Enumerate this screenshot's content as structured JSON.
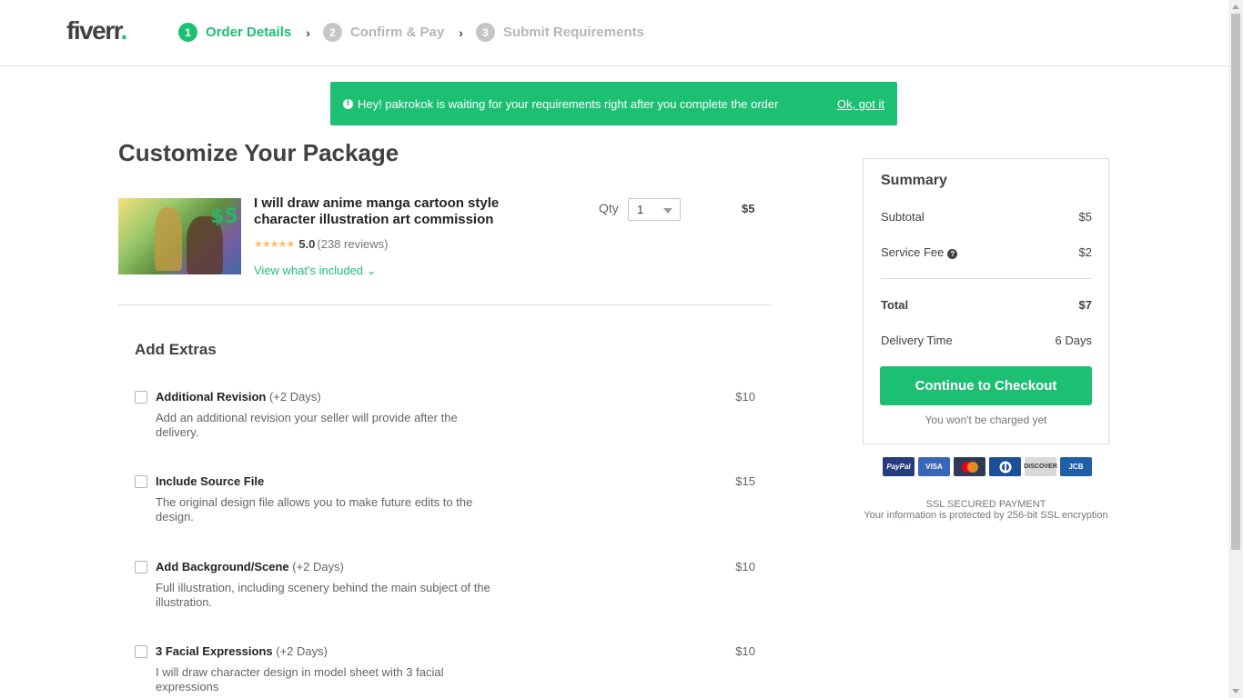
{
  "header": {
    "logo_text": "fiverr",
    "logo_dot": ".",
    "steps": [
      {
        "num": "1",
        "label": "Order Details",
        "state": "active"
      },
      {
        "num": "2",
        "label": "Confirm & Pay",
        "state": "inactive"
      },
      {
        "num": "3",
        "label": "Submit Requirements",
        "state": "inactive"
      }
    ],
    "separator": "›"
  },
  "notice": {
    "icon": "info-icon",
    "text": "Hey! pakrokok is waiting for your requirements right after you complete the order",
    "ok_label": "Ok, got it"
  },
  "main": {
    "title": "Customize Your Package",
    "gig": {
      "thumb_price": "$5",
      "title": "I will draw anime manga cartoon style character illustration art commission",
      "stars": "★★★★★",
      "rating": "5.0",
      "reviews": "(238 reviews)",
      "view_included": "View what's included ⌄",
      "qty_label": "Qty",
      "qty_value": "1",
      "price": "$5"
    },
    "extras_title": "Add Extras",
    "extras": [
      {
        "name": "Additional Revision",
        "days": "(+2 Days)",
        "desc": "Add an additional revision your seller will provide after the delivery.",
        "price": "$10"
      },
      {
        "name": "Include Source File",
        "days": "",
        "desc": "The original design file allows you to make future edits to the design.",
        "price": "$15"
      },
      {
        "name": "Add Background/Scene",
        "days": "(+2 Days)",
        "desc": "Full illustration, including scenery behind the main subject of the illustration.",
        "price": "$10"
      },
      {
        "name": "3 Facial Expressions",
        "days": "(+2 Days)",
        "desc": "I will draw character design in model sheet with 3 facial expressions",
        "price": "$10"
      }
    ]
  },
  "summary": {
    "title": "Summary",
    "subtotal_label": "Subtotal",
    "subtotal_value": "$5",
    "fee_label": "Service Fee",
    "fee_value": "$2",
    "total_label": "Total",
    "total_value": "$7",
    "delivery_label": "Delivery Time",
    "delivery_value": "6 Days",
    "checkout_label": "Continue to Checkout",
    "no_charge": "You won't be charged yet"
  },
  "payments": [
    {
      "name": "PayPal",
      "color": "#253b80"
    },
    {
      "name": "VISA",
      "color": "#3a66b8"
    },
    {
      "name": "MasterCard",
      "color": "#2f3a57"
    },
    {
      "name": "Diners",
      "color": "#1f4e99"
    },
    {
      "name": "DISCOVER",
      "color": "#d9d9d9"
    },
    {
      "name": "JCB",
      "color": "#1f5fa8"
    }
  ],
  "secure": {
    "title": "SSL SECURED PAYMENT",
    "text": "Your information is protected by 256-bit SSL encryption"
  },
  "colors": {
    "accent": "#1dbf73",
    "text": "#404145"
  }
}
